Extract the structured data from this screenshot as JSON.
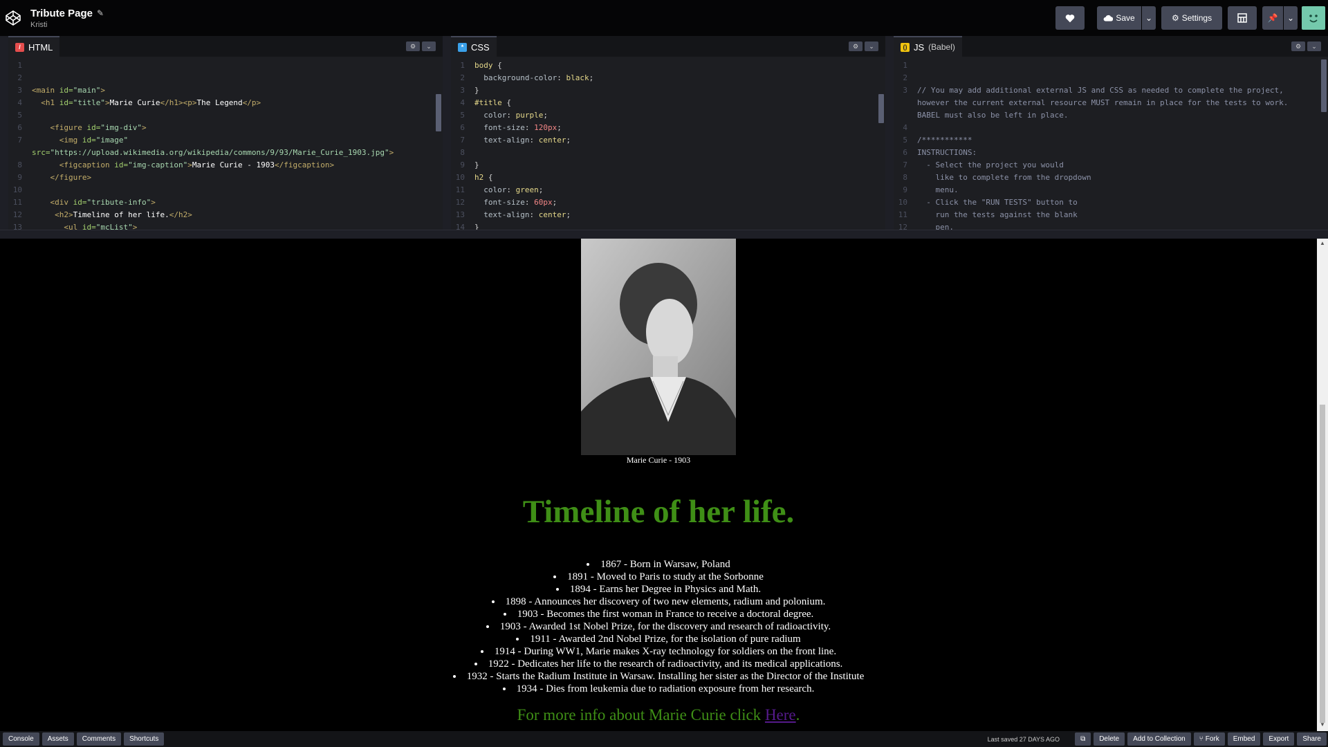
{
  "header": {
    "pen_title": "Tribute Page",
    "author": "Kristi",
    "save_label": "Save",
    "settings_label": "Settings"
  },
  "editors": {
    "html": {
      "label": "HTML",
      "lines": [
        {
          "n": "1",
          "html": ""
        },
        {
          "n": "2",
          "html": ""
        },
        {
          "n": "3",
          "html": "<span class='t-tag'>&lt;main</span> <span class='t-attr'>id=</span><span class='t-str'>\"main\"</span><span class='t-tag'>&gt;</span>"
        },
        {
          "n": "4",
          "html": "  <span class='t-tag'>&lt;h1</span> <span class='t-attr'>id=</span><span class='t-str'>\"title\"</span><span class='t-tag'>&gt;</span><span class='t-txt'>Marie Curie</span><span class='t-tag'>&lt;/h1&gt;&lt;p&gt;</span><span class='t-txt'>The Legend</span><span class='t-tag'>&lt;/p&gt;</span>"
        },
        {
          "n": "5",
          "html": ""
        },
        {
          "n": "6",
          "html": "    <span class='t-tag'>&lt;figure</span> <span class='t-attr'>id=</span><span class='t-str'>\"img-div\"</span><span class='t-tag'>&gt;</span>"
        },
        {
          "n": "7",
          "html": "      <span class='t-tag'>&lt;img</span> <span class='t-attr'>id=</span><span class='t-str'>\"image\"</span>"
        },
        {
          "n": "",
          "html": "<span class='t-attr'>src=</span><span class='t-str'>\"https://upload.wikimedia.org/wikipedia/commons/9/93/Marie_Curie_1903.jpg\"</span><span class='t-tag'>&gt;</span>"
        },
        {
          "n": "8",
          "html": "      <span class='t-tag'>&lt;figcaption</span> <span class='t-attr'>id=</span><span class='t-str'>\"img-caption\"</span><span class='t-tag'>&gt;</span><span class='t-txt'>Marie Curie - 1903</span><span class='t-tag'>&lt;/figcaption&gt;</span>"
        },
        {
          "n": "9",
          "html": "    <span class='t-tag'>&lt;/figure&gt;</span>"
        },
        {
          "n": "10",
          "html": ""
        },
        {
          "n": "11",
          "html": "    <span class='t-tag'>&lt;div</span> <span class='t-attr'>id=</span><span class='t-str'>\"tribute-info\"</span><span class='t-tag'>&gt;</span>"
        },
        {
          "n": "12",
          "html": "     <span class='t-tag'>&lt;h2&gt;</span><span class='t-txt'>Timeline of her life.</span><span class='t-tag'>&lt;/h2&gt;</span>"
        },
        {
          "n": "13",
          "html": "       <span class='t-tag'>&lt;ul</span> <span class='t-attr'>id=</span><span class='t-str'>\"mcList\"</span><span class='t-tag'>&gt;</span>"
        }
      ]
    },
    "css": {
      "label": "CSS",
      "lines": [
        {
          "n": "1",
          "html": "<span class='t-sel'>body</span> {"
        },
        {
          "n": "2",
          "html": "  <span class='t-prop'>background-color</span>: <span class='t-val'>black</span>;"
        },
        {
          "n": "3",
          "html": "}"
        },
        {
          "n": "4",
          "html": "<span class='t-sel'>#title</span> {"
        },
        {
          "n": "5",
          "html": "  <span class='t-prop'>color</span>: <span class='t-val'>purple</span>;"
        },
        {
          "n": "6",
          "html": "  <span class='t-prop'>font-size</span>: <span class='t-num'>120px</span>;"
        },
        {
          "n": "7",
          "html": "  <span class='t-prop'>text-align</span>: <span class='t-val'>center</span>;"
        },
        {
          "n": "8",
          "html": ""
        },
        {
          "n": "9",
          "html": "}"
        },
        {
          "n": "10",
          "html": "<span class='t-sel'>h2</span> {"
        },
        {
          "n": "11",
          "html": "  <span class='t-prop'>color</span>: <span class='t-val'>green</span>;"
        },
        {
          "n": "12",
          "html": "  <span class='t-prop'>font-size</span>: <span class='t-num'>60px</span>;"
        },
        {
          "n": "13",
          "html": "  <span class='t-prop'>text-align</span>: <span class='t-val'>center</span>;"
        },
        {
          "n": "14",
          "html": "}"
        }
      ]
    },
    "js": {
      "label": "JS",
      "sublabel": "(Babel)",
      "lines": [
        {
          "n": "1",
          "html": ""
        },
        {
          "n": "2",
          "html": ""
        },
        {
          "n": "3",
          "html": "<span class='t-com'>// You may add additional external JS and CSS as needed to complete the project,</span>"
        },
        {
          "n": "",
          "html": "<span class='t-com'>however the current external resource MUST remain in place for the tests to work.</span>"
        },
        {
          "n": "",
          "html": "<span class='t-com'>BABEL must also be left in place.</span>"
        },
        {
          "n": "4",
          "html": ""
        },
        {
          "n": "5",
          "html": "<span class='t-com'>/***********</span>"
        },
        {
          "n": "6",
          "html": "<span class='t-com'>INSTRUCTIONS:</span>"
        },
        {
          "n": "7",
          "html": "<span class='t-com'>  - Select the project you would</span>"
        },
        {
          "n": "8",
          "html": "<span class='t-com'>    like to complete from the dropdown</span>"
        },
        {
          "n": "9",
          "html": "<span class='t-com'>    menu.</span>"
        },
        {
          "n": "10",
          "html": "<span class='t-com'>  - Click the \"RUN TESTS\" button to</span>"
        },
        {
          "n": "11",
          "html": "<span class='t-com'>    run the tests against the blank</span>"
        },
        {
          "n": "12",
          "html": "<span class='t-com'>    pen.</span>"
        }
      ]
    }
  },
  "preview": {
    "caption": "Marie Curie - 1903",
    "heading": "Timeline of her life.",
    "events": [
      "1867 - Born in Warsaw, Poland",
      "1891 - Moved to Paris to study at the Sorbonne",
      "1894 - Earns her Degree in Physics and Math.",
      "1898 - Announces her discovery of two new elements, radium and polonium.",
      "1903 - Becomes the first woman in France to receive a doctoral degree.",
      "1903 - Awarded 1st Nobel Prize, for the discovery and research of radioactivity.",
      "1911 - Awarded 2nd Nobel Prize, for the isolation of pure radium",
      "1914 - During WW1, Marie makes X-ray technology for soldiers on the front line.",
      "1922 - Dedicates her life to the research of radioactivity, and its medical applications.",
      "1932 - Starts the Radium Institute in Warsaw. Installing her sister as the Director of the Institute",
      "1934 - Dies from leukemia due to radiation exposure from her research."
    ],
    "more_prefix": "For more info about Marie Curie click ",
    "more_link": "Here",
    "more_suffix": "."
  },
  "footer": {
    "left_buttons": [
      "Console",
      "Assets",
      "Comments",
      "Shortcuts"
    ],
    "last_saved": "Last saved 27 DAYS AGO",
    "delete": "Delete",
    "add_to_collection": "Add to Collection",
    "fork": "Fork",
    "embed": "Embed",
    "export": "Export",
    "share": "Share"
  },
  "colors": {
    "header_bg": "#050506",
    "button_bg": "#444857",
    "heading_green": "#3f8f16",
    "link_purple": "#551a8b"
  }
}
